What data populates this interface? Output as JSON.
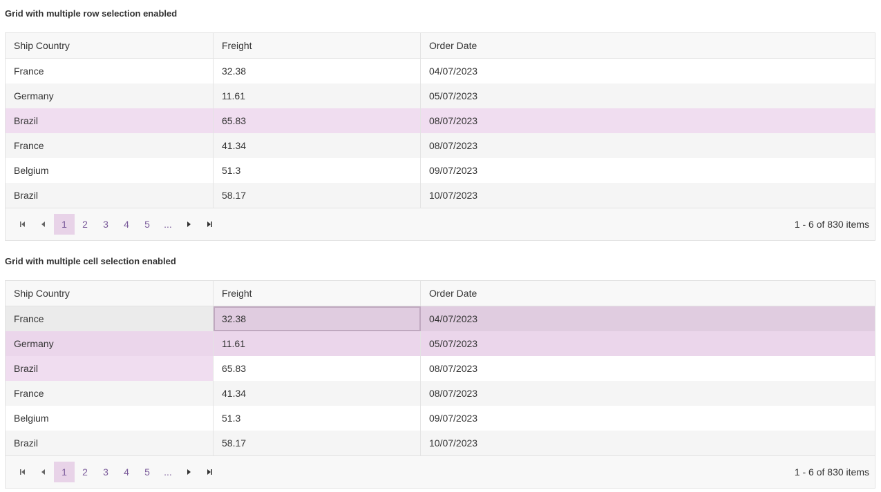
{
  "grid1": {
    "title": "Grid with multiple row selection enabled",
    "columns": [
      "Ship Country",
      "Freight",
      "Order Date"
    ],
    "rows": [
      [
        "France",
        "32.38",
        "04/07/2023"
      ],
      [
        "Germany",
        "11.61",
        "05/07/2023"
      ],
      [
        "Brazil",
        "65.83",
        "08/07/2023"
      ],
      [
        "France",
        "41.34",
        "08/07/2023"
      ],
      [
        "Belgium",
        "51.3",
        "09/07/2023"
      ],
      [
        "Brazil",
        "58.17",
        "10/07/2023"
      ]
    ],
    "pager": {
      "pages": [
        "1",
        "2",
        "3",
        "4",
        "5",
        "..."
      ],
      "active_page": "1",
      "info": "1 - 6 of 830 items"
    }
  },
  "grid2": {
    "title": "Grid with multiple cell selection enabled",
    "columns": [
      "Ship Country",
      "Freight",
      "Order Date"
    ],
    "rows": [
      [
        "France",
        "32.38",
        "04/07/2023"
      ],
      [
        "Germany",
        "11.61",
        "05/07/2023"
      ],
      [
        "Brazil",
        "65.83",
        "08/07/2023"
      ],
      [
        "France",
        "41.34",
        "08/07/2023"
      ],
      [
        "Belgium",
        "51.3",
        "09/07/2023"
      ],
      [
        "Brazil",
        "58.17",
        "10/07/2023"
      ]
    ],
    "pager": {
      "pages": [
        "1",
        "2",
        "3",
        "4",
        "5",
        "..."
      ],
      "active_page": "1",
      "info": "1 - 6 of 830 items"
    }
  },
  "icons": {
    "first": "first-page-icon",
    "prev": "previous-page-icon",
    "next": "next-page-icon",
    "last": "last-page-icon"
  },
  "colors": {
    "accent": "#7a5a9a",
    "selected_row": "#f0ddf0",
    "active_page": "#e8d3e8"
  }
}
